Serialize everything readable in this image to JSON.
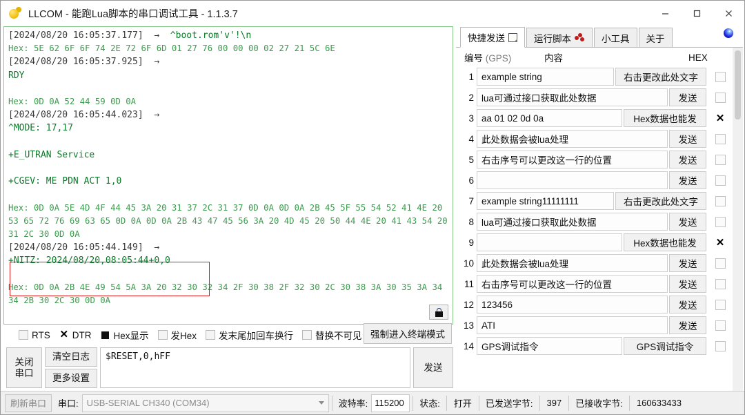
{
  "window": {
    "title": "LLCOM - 能跑Lua脚本的串口调试工具 - 1.1.3.7",
    "icon": "llcom-logo-icon",
    "minimize": "—",
    "maximize": "□",
    "close": "✕"
  },
  "log": {
    "lines": [
      {
        "type": "ts",
        "ts": "[2024/08/20 16:05:37.177]",
        "arrow": "→",
        "data": "^boot.rom'v'!\\n"
      },
      {
        "type": "hex",
        "text": "Hex: 5E 62 6F 6F 74 2E 72 6F 6D 01 27 76 00 00 00 02 27 21 5C 6E"
      },
      {
        "type": "ts",
        "ts": "[2024/08/20 16:05:37.925]",
        "arrow": "→",
        "data": ""
      },
      {
        "type": "data",
        "text": "RDY"
      },
      {
        "type": "blank",
        "text": ""
      },
      {
        "type": "hex",
        "text": "Hex: 0D 0A 52 44 59 0D 0A"
      },
      {
        "type": "ts",
        "ts": "[2024/08/20 16:05:44.023]",
        "arrow": "→",
        "data": ""
      },
      {
        "type": "data",
        "text": "^MODE: 17,17"
      },
      {
        "type": "blank",
        "text": ""
      },
      {
        "type": "data",
        "text": "+E_UTRAN Service"
      },
      {
        "type": "blank",
        "text": ""
      },
      {
        "type": "data",
        "text": "+CGEV: ME PDN ACT 1,0"
      },
      {
        "type": "blank",
        "text": ""
      },
      {
        "type": "hex",
        "text": "Hex: 0D 0A 5E 4D 4F 44 45 3A 20 31 37 2C 31 37 0D 0A 0D 0A 2B 45 5F 55 54 52 41 4E 20 53 65 72 76 69 63 65 0D 0A 0D 0A 2B 43 47 45 56 3A 20 4D 45 20 50 44 4E 20 41 43 54 20 31 2C 30 0D 0A"
      },
      {
        "type": "ts",
        "ts": "[2024/08/20 16:05:44.149]",
        "arrow": "→",
        "data": ""
      },
      {
        "type": "data",
        "text": "+NITZ: 2024/08/20,08:05:44+0,0"
      },
      {
        "type": "blank",
        "text": ""
      },
      {
        "type": "hex",
        "text": "Hex: 0D 0A 2B 4E 49 54 5A 3A 20 32 30 32 34 2F 30 38 2F 32 30 2C 30 38 3A 30 35 3A 34 34 2B 30 2C 30 0D 0A"
      }
    ],
    "highlight_box_color": "#e01b1b",
    "lock_button": "lock-icon"
  },
  "options": {
    "items": [
      {
        "label": "RTS",
        "state": "unchecked"
      },
      {
        "label": "DTR",
        "state": "x"
      },
      {
        "label": "Hex显示",
        "state": "filled"
      },
      {
        "label": "发Hex",
        "state": "unchecked"
      },
      {
        "label": "发末尾加回车换行",
        "state": "unchecked"
      },
      {
        "label": "替换不可见",
        "state": "unchecked"
      }
    ],
    "force_terminal_button": "强制进入终端模式"
  },
  "send_bar": {
    "close_port": "关闭\n串口",
    "clear_log": "清空日志",
    "more_settings": "更多设置",
    "input_value": "$RESET,0,hFF",
    "send_button": "发送"
  },
  "tabs": [
    {
      "label": "快捷发送",
      "icon": "note-icon",
      "active": true
    },
    {
      "label": "运行脚本",
      "icon": "molecule-icon",
      "active": false
    },
    {
      "label": "小工具",
      "icon": "",
      "active": false
    },
    {
      "label": "关于",
      "icon": "",
      "active": false
    }
  ],
  "tabs_right_icon": "globe-icon",
  "quick_send": {
    "headers": {
      "num": "编号",
      "num_note": "(GPS)",
      "content": "内容",
      "hex": "HEX"
    },
    "rows": [
      {
        "index": "1",
        "value": "example string",
        "button": "右击更改此处文字",
        "btn_width": "wide",
        "hex": "unchecked"
      },
      {
        "index": "2",
        "value": "lua可通过接口获取此处数据",
        "button": "发送",
        "btn_width": "send",
        "hex": "unchecked"
      },
      {
        "index": "3",
        "value": "aa 01 02 0d 0a",
        "button": "Hex数据也能发",
        "btn_width": "hex",
        "hex": "x"
      },
      {
        "index": "4",
        "value": "此处数据会被lua处理",
        "button": "发送",
        "btn_width": "send",
        "hex": "unchecked"
      },
      {
        "index": "5",
        "value": "右击序号可以更改这一行的位置",
        "button": "发送",
        "btn_width": "send",
        "hex": "unchecked"
      },
      {
        "index": "6",
        "value": "",
        "button": "发送",
        "btn_width": "send",
        "hex": "unchecked"
      },
      {
        "index": "7",
        "value": "example string11111111",
        "button": "右击更改此处文字",
        "btn_width": "wide",
        "hex": "unchecked"
      },
      {
        "index": "8",
        "value": "lua可通过接口获取此处数据",
        "button": "发送",
        "btn_width": "send",
        "hex": "unchecked"
      },
      {
        "index": "9",
        "value": "",
        "button": "Hex数据也能发",
        "btn_width": "hex",
        "hex": "x"
      },
      {
        "index": "10",
        "value": "此处数据会被lua处理",
        "button": "发送",
        "btn_width": "send",
        "hex": "unchecked"
      },
      {
        "index": "11",
        "value": "右击序号可以更改这一行的位置",
        "button": "发送",
        "btn_width": "send",
        "hex": "unchecked"
      },
      {
        "index": "12",
        "value": "123456",
        "button": "发送",
        "btn_width": "send",
        "hex": "unchecked"
      },
      {
        "index": "13",
        "value": "ATI",
        "button": "发送",
        "btn_width": "send",
        "hex": "unchecked"
      },
      {
        "index": "14",
        "value": "GPS调试指令",
        "button": "GPS调试指令",
        "btn_width": "hex",
        "hex": "unchecked"
      }
    ]
  },
  "status_bar": {
    "refresh_port": "刷新串口",
    "port_label": "串口:",
    "port_value": "USB-SERIAL CH340 (COM34)",
    "baud_label": "波特率:",
    "baud_value": "115200",
    "state_label": "状态:",
    "state_value": "打开",
    "sent_label": "已发送字节:",
    "sent_value": "397",
    "recv_label": "已接收字节:",
    "recv_value": "160633433"
  },
  "colors": {
    "log_border": "#86c98a",
    "log_data": "#0b7a28",
    "log_hex": "#3d9a4e",
    "highlight": "#e01b1b"
  }
}
